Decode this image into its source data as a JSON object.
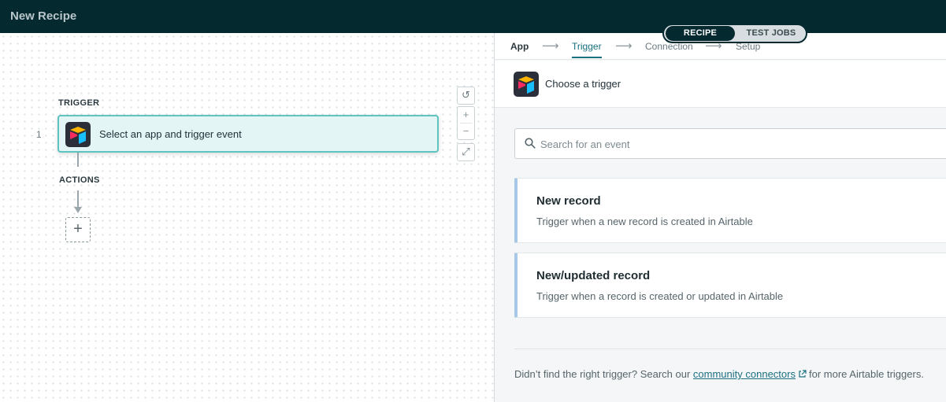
{
  "app": {
    "title": "New Recipe"
  },
  "mode_toggle": {
    "active": "RECIPE",
    "inactive": "TEST JOBS"
  },
  "canvas": {
    "trigger_label": "TRIGGER",
    "step_number": "1",
    "trigger_step_text": "Select an app and trigger event",
    "actions_label": "ACTIONS",
    "add_step_symbol": "+",
    "controls": {
      "reset": "↺",
      "zoom_in": "+",
      "zoom_out": "−",
      "fit": "⤢"
    }
  },
  "wizard": {
    "steps": [
      {
        "label": "App",
        "state": "done"
      },
      {
        "label": "Trigger",
        "state": "current"
      },
      {
        "label": "Connection",
        "state": "pending"
      },
      {
        "label": "Setup",
        "state": "pending"
      }
    ],
    "separator": "⟶"
  },
  "panel": {
    "header": "Choose a trigger",
    "search": {
      "placeholder": "Search for an event",
      "value": ""
    },
    "events": [
      {
        "name": "New record",
        "description": "Trigger when a new record is created in Airtable"
      },
      {
        "name": "New/updated record",
        "description": "Trigger when a record is created or updated in Airtable"
      }
    ],
    "footer": {
      "prefix": "Didn’t find the right trigger? Search our",
      "link": "community connectors",
      "suffix": "for more Airtable triggers."
    }
  },
  "colors": {
    "topbar": "#04292f",
    "accent": "#1a6f80",
    "trigger_card_bg": "#e3f6f5",
    "trigger_card_border": "#5fc3c0",
    "event_card_accent": "#a7c8e8"
  },
  "icons": [
    "airtable-logo-icon",
    "search-icon",
    "external-link-icon",
    "reset-icon",
    "zoom-in-icon",
    "zoom-out-icon",
    "fit-view-icon",
    "plus-icon"
  ]
}
